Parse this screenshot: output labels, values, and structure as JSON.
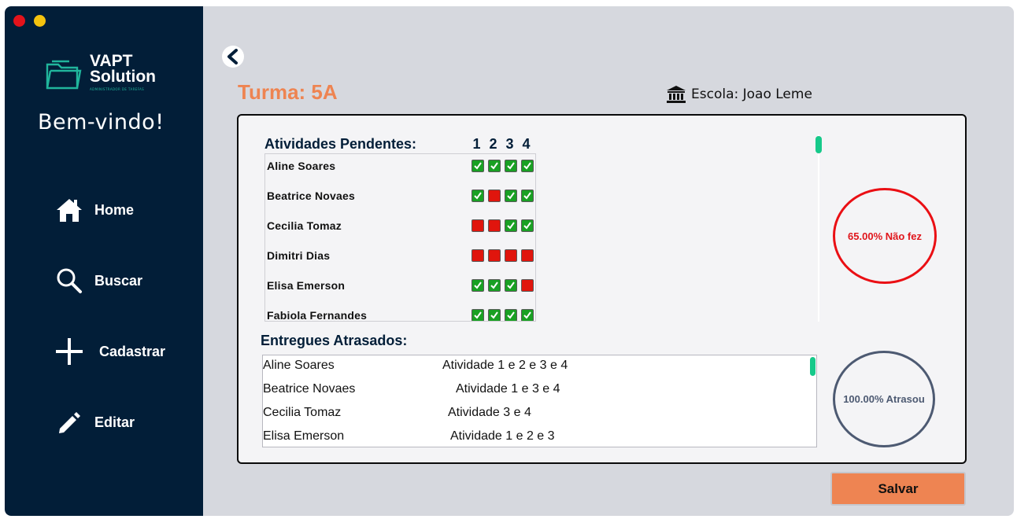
{
  "sidebar": {
    "logo": {
      "title_line1": "VAPT",
      "title_line2": "Solution",
      "tagline": "ADMINISTRADOR DE TAREFAS"
    },
    "welcome": "Bem-vindo!",
    "items": [
      {
        "label": "Home",
        "icon": "home-icon"
      },
      {
        "label": "Buscar",
        "icon": "search-icon"
      },
      {
        "label": "Cadastrar",
        "icon": "plus-icon"
      },
      {
        "label": "Editar",
        "icon": "pencil-icon"
      }
    ]
  },
  "header": {
    "turma": "Turma: 5A",
    "escola": "Escola: Joao Leme"
  },
  "pendentes": {
    "title": "Atividades Pendentes:",
    "columns": [
      "1",
      "2",
      "3",
      "4"
    ],
    "rows": [
      {
        "name": "Aline Soares",
        "status": [
          true,
          true,
          true,
          true
        ]
      },
      {
        "name": "Beatrice Novaes",
        "status": [
          true,
          false,
          true,
          true
        ]
      },
      {
        "name": "Cecilia Tomaz",
        "status": [
          false,
          false,
          true,
          true
        ]
      },
      {
        "name": "Dimitri Dias",
        "status": [
          false,
          false,
          false,
          false
        ]
      },
      {
        "name": "Elisa Emerson",
        "status": [
          true,
          true,
          true,
          false
        ]
      },
      {
        "name": "Fabiola Fernandes",
        "status": [
          true,
          true,
          true,
          true
        ]
      }
    ]
  },
  "atrasados": {
    "title": "Entregues Atrasados:",
    "rows": [
      {
        "name": "Aline Soares",
        "atividades": "Atividade 1 e 2 e 3 e 4"
      },
      {
        "name": "Beatrice Novaes",
        "atividades": "Atividade 1 e 3 e 4"
      },
      {
        "name": "Cecilia Tomaz",
        "atividades": "Atividade 3 e 4"
      },
      {
        "name": "Elisa Emerson",
        "atividades": "Atividade 1 e 2 e 3"
      }
    ]
  },
  "stats": {
    "nao_fez": "65.00% Não fez",
    "atrasou": "100.00% Atrasou"
  },
  "actions": {
    "save_label": "Salvar"
  },
  "colors": {
    "sidebar_bg": "#021e38",
    "accent_orange": "#ee8451",
    "ok_green": "#19a023",
    "missing_red": "#e0150d",
    "scroll_green": "#16c98a"
  }
}
